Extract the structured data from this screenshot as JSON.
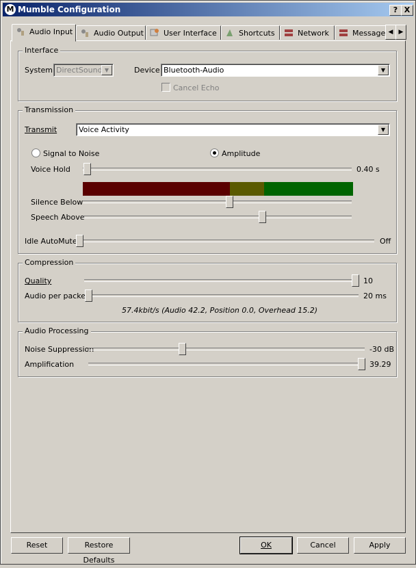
{
  "window": {
    "title": "Mumble Configuration",
    "app_icon": "M",
    "help_button": "?",
    "close_button": "X"
  },
  "tabs": [
    {
      "label": "Audio Input",
      "icon": "microphone-icon",
      "active": true
    },
    {
      "label": "Audio Output",
      "icon": "speaker-icon",
      "active": false
    },
    {
      "label": "User Interface",
      "icon": "interface-icon",
      "active": false
    },
    {
      "label": "Shortcuts",
      "icon": "shortcuts-icon",
      "active": false
    },
    {
      "label": "Network",
      "icon": "network-icon",
      "active": false
    },
    {
      "label": "Message",
      "icon": "message-icon",
      "active": false
    }
  ],
  "interface": {
    "group_title": "Interface",
    "system_label": "System",
    "system_value": "DirectSound",
    "device_label": "Device",
    "device_value": "Bluetooth-Audio",
    "cancel_echo_label": "Cancel Echo"
  },
  "transmission": {
    "group_title": "Transmission",
    "transmit_label": "Transmit",
    "transmit_value": "Voice Activity",
    "signal_to_noise_label": "Signal to Noise",
    "amplitude_label": "Amplitude",
    "selected_mode": "Amplitude",
    "voice_hold_label": "Voice Hold",
    "voice_hold_value": "0.40 s",
    "silence_below_label": "Silence Below",
    "speech_above_label": "Speech Above",
    "idle_automute_label": "Idle AutoMute",
    "idle_automute_value": "Off",
    "meter_colors": {
      "silence": "#5a0000",
      "between": "#5a5a00",
      "speech": "#006400"
    }
  },
  "compression": {
    "group_title": "Compression",
    "quality_label": "Quality",
    "quality_value": "10",
    "audio_per_packet_label": "Audio per packet",
    "audio_per_packet_value": "20 ms",
    "bitrate_summary": "57.4kbit/s (Audio 42.2, Position 0.0, Overhead 15.2)"
  },
  "audio_processing": {
    "group_title": "Audio Processing",
    "noise_suppression_label": "Noise Suppression",
    "noise_suppression_value": "-30 dB",
    "amplification_label": "Amplification",
    "amplification_value": "39.29"
  },
  "buttons": {
    "reset": "Reset",
    "restore_defaults": "Restore Defaults",
    "ok": "OK",
    "cancel": "Cancel",
    "apply": "Apply"
  }
}
